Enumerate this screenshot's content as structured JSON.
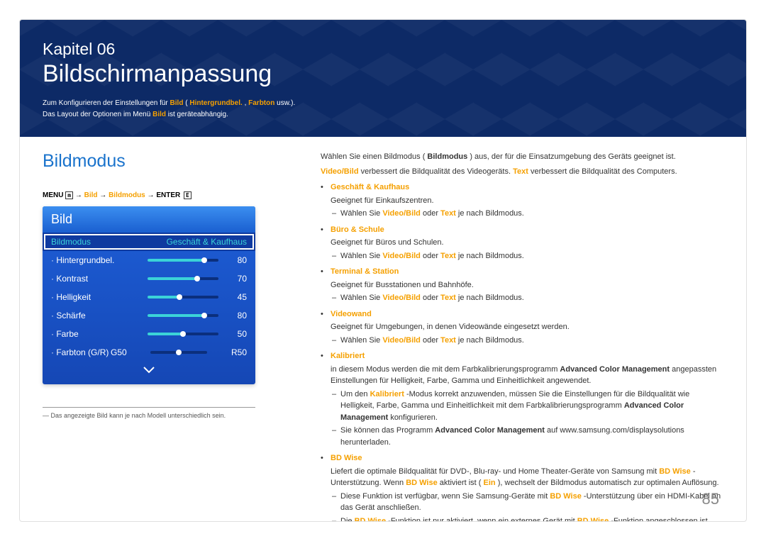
{
  "header": {
    "kicker": "Kapitel 06",
    "title": "Bildschirmanpassung",
    "intro_pre": "Zum Konfigurieren der Einstellungen für ",
    "intro_term1": "Bild",
    "intro_paren_open": " (",
    "intro_term2": "Hintergrundbel.",
    "intro_sep": ", ",
    "intro_term3": "Farbton",
    "intro_post": " usw.).",
    "intro_line2_pre": "Das Layout der Optionen im Menü ",
    "intro_line2_term": "Bild",
    "intro_line2_post": " ist geräteabhängig."
  },
  "section": {
    "title": "Bildmodus",
    "menu_path_pre": "MENU ",
    "menu_path_icon": "m",
    "menu_path_arrow": " → ",
    "menu_path_p1": "Bild",
    "menu_path_p2": "Bildmodus",
    "menu_path_p3": "ENTER",
    "menu_path_enter_icon": "E"
  },
  "panel": {
    "head": "Bild",
    "selected": {
      "label": "Bildmodus",
      "value": "Geschäft & Kaufhaus"
    },
    "rows": [
      {
        "label": "Hintergrundbel.",
        "value": 80
      },
      {
        "label": "Kontrast",
        "value": 70
      },
      {
        "label": "Helligkeit",
        "value": 45
      },
      {
        "label": "Schärfe",
        "value": 80
      },
      {
        "label": "Farbe",
        "value": 50
      }
    ],
    "farbton": {
      "label": "Farbton (G/R)",
      "left": "G50",
      "right": "R50"
    }
  },
  "footnote": "Das angezeigte Bild kann je nach Modell unterschiedlich sein.",
  "rc": {
    "p1_pre": "Wählen Sie einen Bildmodus (",
    "p1_bold": "Bildmodus",
    "p1_post": ") aus, der für die Einsatzumgebung des Geräts geeignet ist.",
    "p2_a": "Video/Bild",
    "p2_b": " verbessert die Bildqualität des Videogeräts. ",
    "p2_c": "Text",
    "p2_d": " verbessert die Bildqualität des Computers.",
    "videobild_note_pre": "Wählen Sie ",
    "videobild_note_vb": "Video/Bild",
    "videobild_note_mid": " oder ",
    "videobild_note_text": "Text",
    "videobild_note_post": " je nach Bildmodus."
  },
  "modes": [
    {
      "name": "Geschäft & Kaufhaus",
      "desc": "Geeignet für Einkaufszentren.",
      "has_vb_note": true
    },
    {
      "name": "Büro & Schule",
      "desc": "Geeignet für Büros und Schulen.",
      "has_vb_note": true
    },
    {
      "name": "Terminal & Station",
      "desc": "Geeignet für Busstationen und Bahnhöfe.",
      "has_vb_note": true
    },
    {
      "name": "Videowand",
      "desc": "Geeignet für Umgebungen, in denen Videowände eingesetzt werden.",
      "has_vb_note": true
    }
  ],
  "kalibriert": {
    "name": "Kalibriert",
    "desc_pre": "in diesem Modus werden die mit dem Farbkalibrierungsprogramm ",
    "desc_bold": "Advanced Color Management",
    "desc_post": " angepassten Einstellungen für Helligkeit, Farbe, Gamma und Einheitlichkeit angewendet.",
    "note1_pre": "Um den ",
    "note1_k": "Kalibriert",
    "note1_mid": "-Modus korrekt anzuwenden, müssen Sie die Einstellungen für die Bildqualität wie Helligkeit, Farbe, Gamma und Einheitlichkeit mit dem Farbkalibrierungsprogramm ",
    "note1_bold": "Advanced Color Management",
    "note1_post": " konfigurieren.",
    "note2_pre": "Sie können das Programm ",
    "note2_bold": "Advanced Color Management",
    "note2_post": " auf www.samsung.com/displaysolutions herunterladen."
  },
  "bdwise": {
    "name": "BD Wise",
    "desc_pre": "Liefert die optimale Bildqualität für DVD-, Blu-ray- und Home Theater-Geräte von Samsung mit ",
    "desc_bd": "BD Wise",
    "desc_mid": "-Unterstützung. Wenn ",
    "desc_bd2": "BD Wise",
    "desc_mid2": " aktiviert ist (",
    "desc_ein": "Ein",
    "desc_post": "), wechselt der Bildmodus automatisch zur optimalen Auflösung.",
    "note1_pre": "Diese Funktion ist verfügbar, wenn Sie Samsung-Geräte mit ",
    "note1_bd": "BD Wise",
    "note1_post": "-Unterstützung über ein HDMI-Kabel an das Gerät anschließen.",
    "note2_pre": "Die ",
    "note2_bd": "BD Wise",
    "note2_mid": "-Funktion ist nur aktiviert, wenn ein externes Gerät mit ",
    "note2_bd2": "BD Wise",
    "note2_post": "-Funktion angeschlossen ist."
  },
  "page_number": "85"
}
